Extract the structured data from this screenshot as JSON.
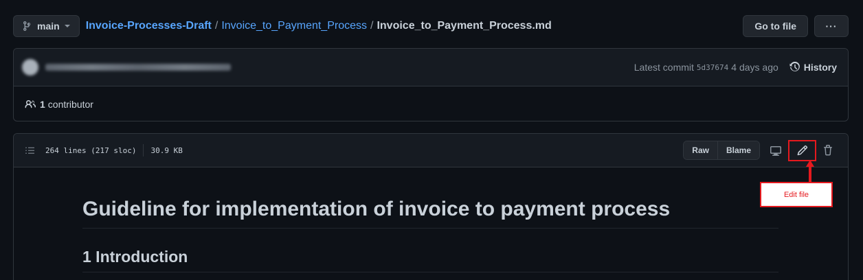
{
  "header": {
    "branch": "main",
    "repo": "Invoice-Processes-Draft",
    "folder": "Invoice_to_Payment_Process",
    "file": "Invoice_to_Payment_Process.md",
    "separator": "/",
    "go_to_file": "Go to file",
    "more": "···"
  },
  "commit": {
    "latest_label": "Latest commit",
    "sha": "5d37674",
    "age": "4 days ago",
    "history": "History",
    "contributors_count": "1",
    "contributors_label": "contributor"
  },
  "file": {
    "lines": "264 lines (217 sloc)",
    "size": "30.9 KB",
    "raw": "Raw",
    "blame": "Blame"
  },
  "content": {
    "h1": "Guideline for implementation of invoice to payment process",
    "h2": "1 Introduction"
  },
  "annotation": {
    "callout": "Edit file",
    "color": "#e5191e"
  }
}
